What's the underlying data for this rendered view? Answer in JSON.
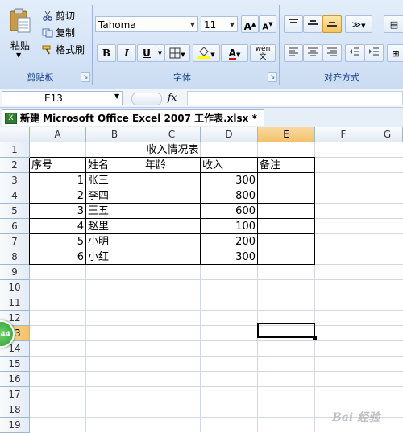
{
  "ribbon": {
    "clipboard": {
      "paste_label": "粘贴",
      "cut_label": "剪切",
      "copy_label": "复制",
      "format_painter_label": "格式刷",
      "group_label": "剪贴板"
    },
    "font": {
      "font_name": "Tahoma",
      "font_size": "11",
      "bold": "B",
      "italic": "I",
      "underline": "U",
      "font_color_letter": "A",
      "phonetic": "wén",
      "group_label": "字体"
    },
    "alignment": {
      "group_label": "对齐方式"
    }
  },
  "formula_bar": {
    "name_box": "E13",
    "fx_label": "fx",
    "formula": ""
  },
  "workbook_tab": {
    "title": "新建 Microsoft Office Excel 2007 工作表.xlsx *"
  },
  "grid": {
    "columns": [
      "A",
      "B",
      "C",
      "D",
      "E",
      "F",
      "G"
    ],
    "rows": [
      "1",
      "2",
      "3",
      "4",
      "5",
      "6",
      "7",
      "8",
      "9",
      "10",
      "11",
      "12",
      "13",
      "14",
      "15",
      "16",
      "17",
      "18",
      "19"
    ],
    "title": "收入情况表",
    "headers": [
      "序号",
      "姓名",
      "年龄",
      "收入",
      "备注"
    ],
    "data": [
      {
        "no": "1",
        "name": "张三",
        "age": "",
        "income": "300",
        "note": ""
      },
      {
        "no": "2",
        "name": "李四",
        "age": "",
        "income": "800",
        "note": ""
      },
      {
        "no": "3",
        "name": "王五",
        "age": "",
        "income": "600",
        "note": ""
      },
      {
        "no": "4",
        "name": "赵里",
        "age": "",
        "income": "100",
        "note": ""
      },
      {
        "no": "5",
        "name": "小明",
        "age": "",
        "income": "200",
        "note": ""
      },
      {
        "no": "6",
        "name": "小红",
        "age": "",
        "income": "300",
        "note": ""
      }
    ],
    "selected_cell": "E13"
  },
  "overlay": {
    "badge_text": "44",
    "watermark": "Bai 经验"
  }
}
